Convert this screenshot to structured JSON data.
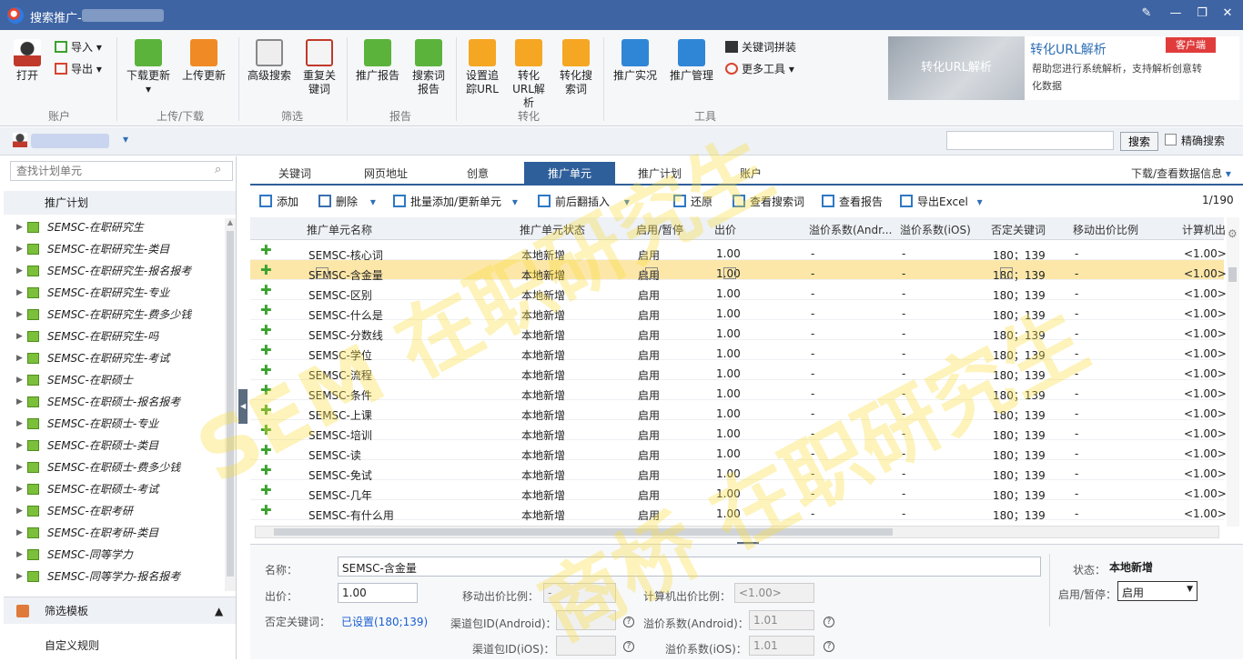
{
  "titlebar": {
    "title": "搜索推广-"
  },
  "ribbon": {
    "open": "打开",
    "import": "导入",
    "export": "导出",
    "download": "下载更新",
    "upload": "上传更新",
    "adv_search": "高级搜索",
    "dup_kw": "重复关键词",
    "report": "推广报告",
    "search_report": "搜索词报告",
    "track_url": "设置追踪URL",
    "convert_url": "转化URL解析",
    "convert_search": "转化搜索词",
    "live": "推广实况",
    "manage": "推广管理",
    "kw_combine": "关键词拼装",
    "more_tools": "更多工具",
    "groups": [
      "账户",
      "上传/下载",
      "筛选",
      "报告",
      "转化",
      "工具"
    ],
    "banner_img": "转化URL解析",
    "banner_title": "转化URL解析",
    "banner_tag": "客户端",
    "banner_desc": "帮助您进行系统解析，支持解析创意转化数据"
  },
  "topbar": {
    "search_btn": "搜索",
    "exact": "精确搜索"
  },
  "left": {
    "search_placeholder": "查找计划单元",
    "head": "推广计划",
    "items": [
      "SEMSC-在职研究生",
      "SEMSC-在职研究生-类目",
      "SEMSC-在职研究生-报名报考",
      "SEMSC-在职研究生-专业",
      "SEMSC-在职研究生-费多少钱",
      "SEMSC-在职研究生-吗",
      "SEMSC-在职研究生-考试",
      "SEMSC-在职硕士",
      "SEMSC-在职硕士-报名报考",
      "SEMSC-在职硕士-专业",
      "SEMSC-在职硕士-类目",
      "SEMSC-在职硕士-费多少钱",
      "SEMSC-在职硕士-考试",
      "SEMSC-在职考研",
      "SEMSC-在职考研-类目",
      "SEMSC-同等学力",
      "SEMSC-同等学力-报名报考"
    ],
    "filter_tpl": "筛选模板",
    "custom_rule": "自定义规则"
  },
  "tabs": [
    "关键词",
    "网页地址",
    "创意",
    "推广单元",
    "推广计划",
    "账户"
  ],
  "download_info": "下载/查看数据信息",
  "actions": {
    "add": "添加",
    "delete": "删除",
    "batch": "批量添加/更新单元",
    "insert": "前后翻插入",
    "restore": "还原",
    "view_search": "查看搜索词",
    "view_report": "查看报告",
    "export": "导出Excel",
    "page": "1/190"
  },
  "columns": [
    "推广单元名称",
    "推广单元状态",
    "启用/暂停",
    "出价",
    "溢价系数(Andr...",
    "溢价系数(iOS)",
    "否定关键词",
    "移动出价比例",
    "计算机出"
  ],
  "rows": [
    [
      "SEMSC-核心词",
      "本地新增",
      "启用",
      "1.00",
      "-",
      "-",
      "180；139",
      "-",
      "<1.00>"
    ],
    [
      "SEMSC-含金量",
      "本地新增",
      "启用",
      "1.00",
      "-",
      "-",
      "180；139",
      "-",
      "<1.00>"
    ],
    [
      "SEMSC-区别",
      "本地新增",
      "启用",
      "1.00",
      "-",
      "-",
      "180；139",
      "-",
      "<1.00>"
    ],
    [
      "SEMSC-什么是",
      "本地新增",
      "启用",
      "1.00",
      "-",
      "-",
      "180；139",
      "-",
      "<1.00>"
    ],
    [
      "SEMSC-分数线",
      "本地新增",
      "启用",
      "1.00",
      "-",
      "-",
      "180；139",
      "-",
      "<1.00>"
    ],
    [
      "SEMSC-学位",
      "本地新增",
      "启用",
      "1.00",
      "-",
      "-",
      "180；139",
      "-",
      "<1.00>"
    ],
    [
      "SEMSC-流程",
      "本地新增",
      "启用",
      "1.00",
      "-",
      "-",
      "180；139",
      "-",
      "<1.00>"
    ],
    [
      "SEMSC-条件",
      "本地新增",
      "启用",
      "1.00",
      "-",
      "-",
      "180；139",
      "-",
      "<1.00>"
    ],
    [
      "SEMSC-上课",
      "本地新增",
      "启用",
      "1.00",
      "-",
      "-",
      "180；139",
      "-",
      "<1.00>"
    ],
    [
      "SEMSC-培训",
      "本地新增",
      "启用",
      "1.00",
      "-",
      "-",
      "180；139",
      "-",
      "<1.00>"
    ],
    [
      "SEMSC-读",
      "本地新增",
      "启用",
      "1.00",
      "-",
      "-",
      "180；139",
      "-",
      "<1.00>"
    ],
    [
      "SEMSC-免试",
      "本地新增",
      "启用",
      "1.00",
      "-",
      "-",
      "180；139",
      "-",
      "<1.00>"
    ],
    [
      "SEMSC-几年",
      "本地新增",
      "启用",
      "1.00",
      "-",
      "-",
      "180；139",
      "-",
      "<1.00>"
    ],
    [
      "SEMSC-有什么用",
      "本地新增",
      "启用",
      "1.00",
      "-",
      "-",
      "180；139",
      "-",
      "<1.00>"
    ]
  ],
  "detail": {
    "name_l": "名称：",
    "name_v": "SEMSC-含金量",
    "bid_l": "出价：",
    "bid_v": "1.00",
    "mobile_l": "移动出价比例：",
    "mobile_v": "-",
    "pc_l": "计算机出价比例：",
    "pc_v": "<1.00>",
    "neg_l": "否定关键词：",
    "neg_v": "已设置(180;139)",
    "and_id_l": "渠道包ID(Android)：",
    "ios_id_l": "渠道包ID(iOS)：",
    "and_rate_l": "溢价系数(Android)：",
    "and_rate_v": "1.01",
    "ios_rate_l": "溢价系数(iOS)：",
    "ios_rate_v": "1.01",
    "status_l": "状态：",
    "status_v": "本地新增",
    "enable_l": "启用/暂停：",
    "enable_v": "启用"
  }
}
